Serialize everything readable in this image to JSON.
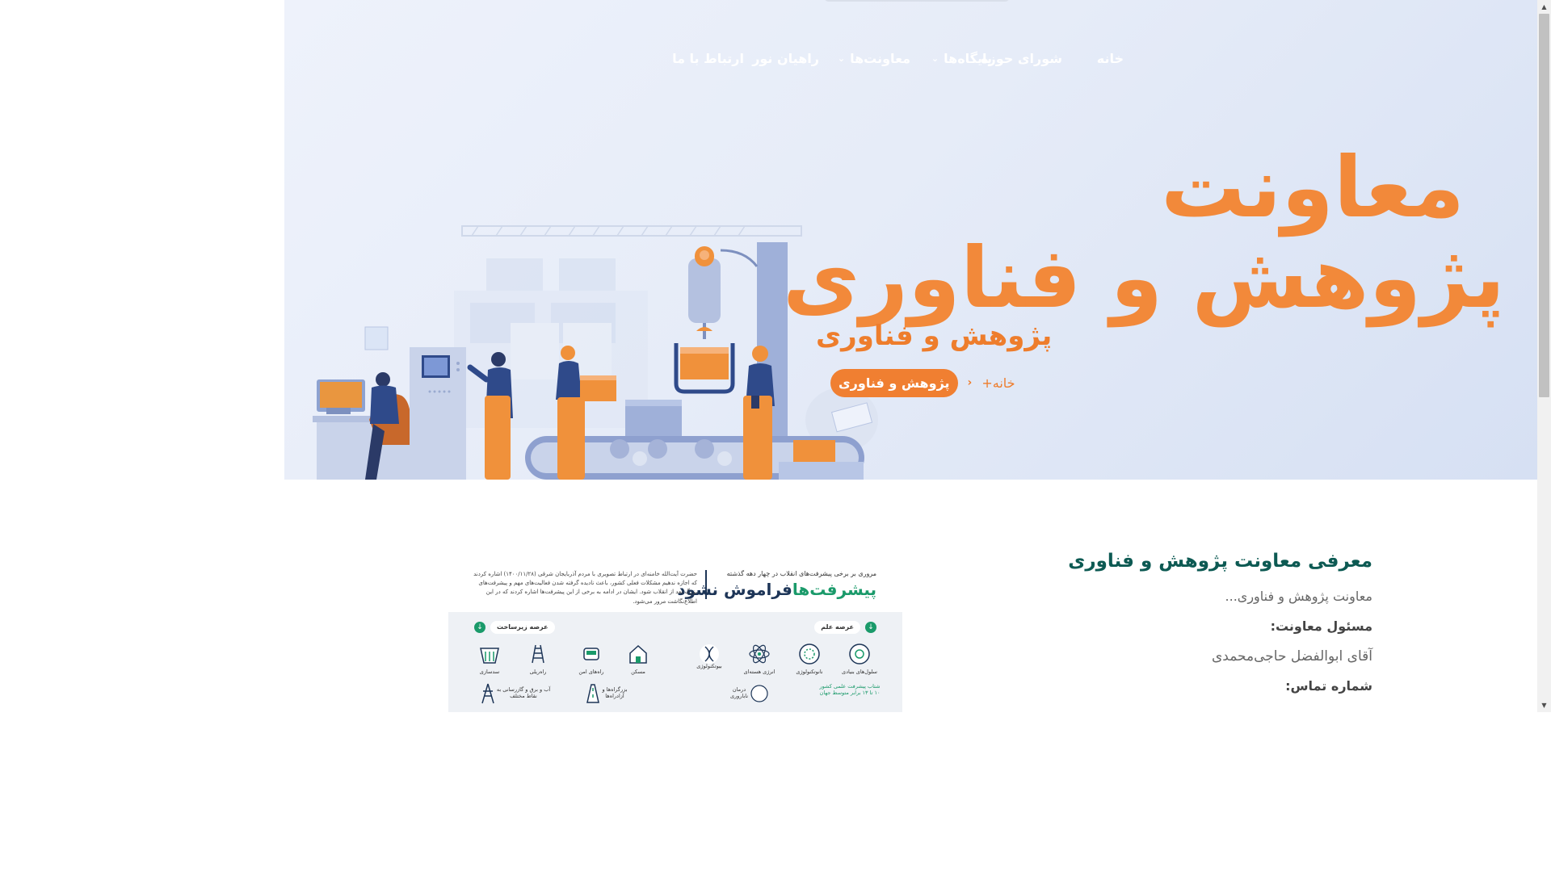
{
  "nav": {
    "items": [
      {
        "label": "خانه",
        "has_dropdown": false
      },
      {
        "label": "شورای حوزه",
        "has_dropdown": false
      },
      {
        "label": "پایگاه‌ها",
        "has_dropdown": true
      },
      {
        "label": "معاونت‌ها",
        "has_dropdown": true
      },
      {
        "label": "راهیان نور",
        "has_dropdown": false
      },
      {
        "label": "ارتباط با ما",
        "has_dropdown": false
      }
    ]
  },
  "hero": {
    "big_title_line1": "معاونت",
    "big_title_line2": "پژوهش و فناوری",
    "page_title": "پژوهش و فناوری",
    "breadcrumb": {
      "home": "خانه",
      "separator": "+",
      "current": "پژوهش و فناوری"
    }
  },
  "content": {
    "title": "معرفی معاونت پژوهش و فناوری",
    "intro": "معاونت پژوهش و فناوری...",
    "manager_label": "مسئول معاونت:",
    "manager_name": "آقای ابوالفضل حاجی‌محمدی",
    "phone_label": "شماره تماس:"
  },
  "poster": {
    "kicker": "مروری بر برخی پیشرفت‌های انقلاب در چهار دهه گذشته",
    "title_green": "پیشرفت‌ها",
    "title_dark": "فراموش نشود",
    "description": "حضرت آیت‌الله خامنه‌ای در ارتباط تصویری با مردم آذربایجان شرقی (۱۴۰۰/۱۱/۲۸) اشاره کردند که اجازه ندهیم مشکلات فعلی کشور، باعث نادیده گرفته شدن فعالیت‌های مهم و پیشرفت‌های بزرگ بعد از انقلاب شود. ایشان در ادامه به برخی از این پیشرفت‌ها اشاره کردند که در این اطلاع‌نگاشت مرور می‌شود.",
    "section_science": "عرصه علم",
    "section_infra": "عرصه زیرساخت",
    "science_items": [
      "سلول‌های بنیادی",
      "نانوتکنولوژی",
      "انرژی هسته‌ای",
      "بیوتکنولوژی"
    ],
    "science_note_1": "شتاب پیشرفت علمی کشور",
    "science_note_2": "۱۰ تا ۱۳ برابر متوسط جهان",
    "science_item_5": "درمان ناباروری",
    "infra_items": [
      "مسکن",
      "راه‌های امن",
      "راه‌ریلی",
      "سدسازی"
    ],
    "infra_item_5": "بزرگراه‌ها و آزادراه‌ها",
    "infra_item_6": "آب و برق و گازرسانی به نقاط مختلف"
  },
  "colors": {
    "accent_orange": "#f2893a",
    "title_teal": "#0d5a53",
    "hero_bg": "#e6ecf8"
  }
}
